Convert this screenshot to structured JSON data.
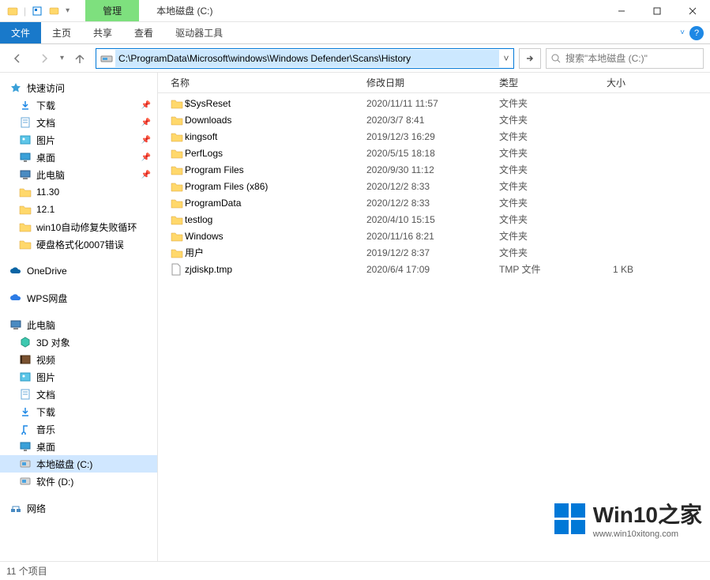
{
  "titlebar": {
    "manage_tab": "管理",
    "title": "本地磁盘 (C:)"
  },
  "ribbon": {
    "file": "文件",
    "home": "主页",
    "share": "共享",
    "view": "查看",
    "drive_tools": "驱动器工具"
  },
  "address": {
    "path": "C:\\ProgramData\\Microsoft\\windows\\Windows Defender\\Scans\\History"
  },
  "search": {
    "placeholder": "搜索\"本地磁盘 (C:)\""
  },
  "sidebar": {
    "quick_access": "快速访问",
    "quick_items": [
      {
        "label": "下载",
        "icon": "download"
      },
      {
        "label": "文档",
        "icon": "doc"
      },
      {
        "label": "图片",
        "icon": "pic"
      },
      {
        "label": "桌面",
        "icon": "desktop"
      },
      {
        "label": "此电脑",
        "icon": "pc"
      },
      {
        "label": "11.30",
        "icon": "folder"
      },
      {
        "label": "12.1",
        "icon": "folder"
      },
      {
        "label": "win10自动修复失败循环",
        "icon": "folder"
      },
      {
        "label": "硬盘格式化0007错误",
        "icon": "folder"
      }
    ],
    "onedrive": "OneDrive",
    "wps": "WPS网盘",
    "this_pc": "此电脑",
    "pc_items": [
      {
        "label": "3D 对象",
        "icon": "3d"
      },
      {
        "label": "视频",
        "icon": "video"
      },
      {
        "label": "图片",
        "icon": "pic"
      },
      {
        "label": "文档",
        "icon": "doc"
      },
      {
        "label": "下载",
        "icon": "download"
      },
      {
        "label": "音乐",
        "icon": "music"
      },
      {
        "label": "桌面",
        "icon": "desktop"
      },
      {
        "label": "本地磁盘 (C:)",
        "icon": "disk",
        "selected": true
      },
      {
        "label": "软件 (D:)",
        "icon": "disk"
      }
    ],
    "network": "网络"
  },
  "columns": {
    "name": "名称",
    "date": "修改日期",
    "type": "类型",
    "size": "大小"
  },
  "files": [
    {
      "name": "$SysReset",
      "date": "2020/11/11 11:57",
      "type": "文件夹",
      "size": "",
      "icon": "folder"
    },
    {
      "name": "Downloads",
      "date": "2020/3/7 8:41",
      "type": "文件夹",
      "size": "",
      "icon": "folder"
    },
    {
      "name": "kingsoft",
      "date": "2019/12/3 16:29",
      "type": "文件夹",
      "size": "",
      "icon": "folder"
    },
    {
      "name": "PerfLogs",
      "date": "2020/5/15 18:18",
      "type": "文件夹",
      "size": "",
      "icon": "folder"
    },
    {
      "name": "Program Files",
      "date": "2020/9/30 11:12",
      "type": "文件夹",
      "size": "",
      "icon": "folder"
    },
    {
      "name": "Program Files (x86)",
      "date": "2020/12/2 8:33",
      "type": "文件夹",
      "size": "",
      "icon": "folder"
    },
    {
      "name": "ProgramData",
      "date": "2020/12/2 8:33",
      "type": "文件夹",
      "size": "",
      "icon": "folder"
    },
    {
      "name": "testlog",
      "date": "2020/4/10 15:15",
      "type": "文件夹",
      "size": "",
      "icon": "folder"
    },
    {
      "name": "Windows",
      "date": "2020/11/16 8:21",
      "type": "文件夹",
      "size": "",
      "icon": "folder"
    },
    {
      "name": "用户",
      "date": "2019/12/2 8:37",
      "type": "文件夹",
      "size": "",
      "icon": "folder"
    },
    {
      "name": "zjdiskp.tmp",
      "date": "2020/6/4 17:09",
      "type": "TMP 文件",
      "size": "1 KB",
      "icon": "file"
    }
  ],
  "status": {
    "count": "11 个项目"
  },
  "watermark": {
    "main": "Win10之家",
    "sub": "www.win10xitong.com"
  }
}
